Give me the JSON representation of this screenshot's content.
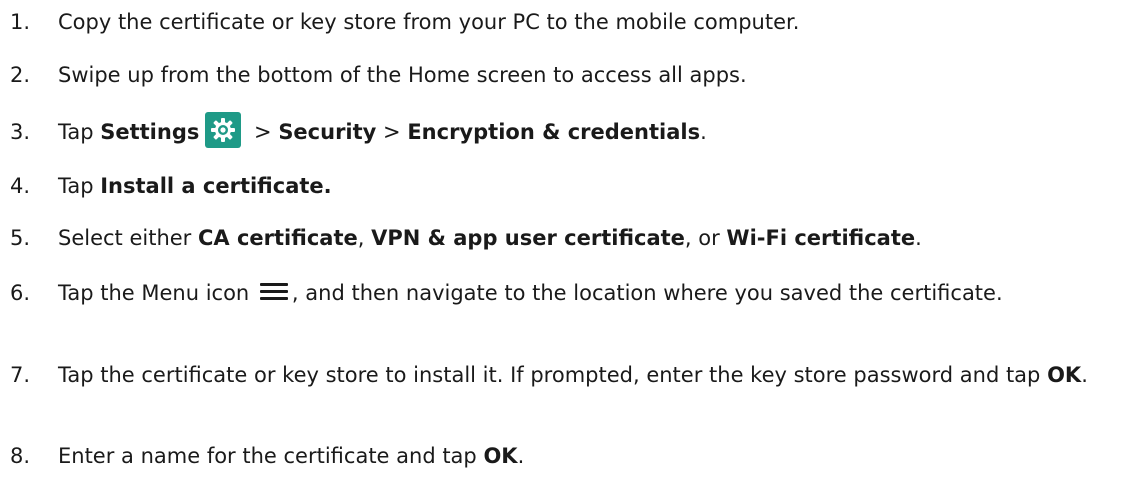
{
  "steps": [
    {
      "num": "1.",
      "text": "Copy the certificate or key store from your PC to the mobile computer."
    },
    {
      "num": "2.",
      "text": "Swipe up from the bottom of the Home screen to access all apps."
    },
    {
      "num": "3.",
      "pre": "Tap ",
      "b1": "Settings",
      "sep1": " > ",
      "b2": "Security",
      "sep2": " > ",
      "b3": "Encryption & credentials",
      "post": "."
    },
    {
      "num": "4.",
      "pre": "Tap ",
      "b1": "Install a certificate."
    },
    {
      "num": "5.",
      "pre": "Select either ",
      "b1": "CA certificate",
      "sep1": ", ",
      "b2": "VPN & app user certificate",
      "sep2": ", or ",
      "b3": "Wi-Fi certificate",
      "post": "."
    },
    {
      "num": "6.",
      "pre": "Tap the Menu icon ",
      "post": ", and then navigate to the location where you saved the certificate."
    },
    {
      "num": "7.",
      "pre": "Tap the certificate or key store to install it. If prompted, enter the key store password and tap ",
      "b1": "OK",
      "post": "."
    },
    {
      "num": "8.",
      "pre": "Enter a name for the certificate and tap ",
      "b1": "OK",
      "post": "."
    }
  ],
  "icons": {
    "settings": "gear-icon",
    "menu": "menu-icon"
  },
  "colors": {
    "settings_icon_bg": "#1f9a87",
    "text": "#1a1a1a"
  }
}
